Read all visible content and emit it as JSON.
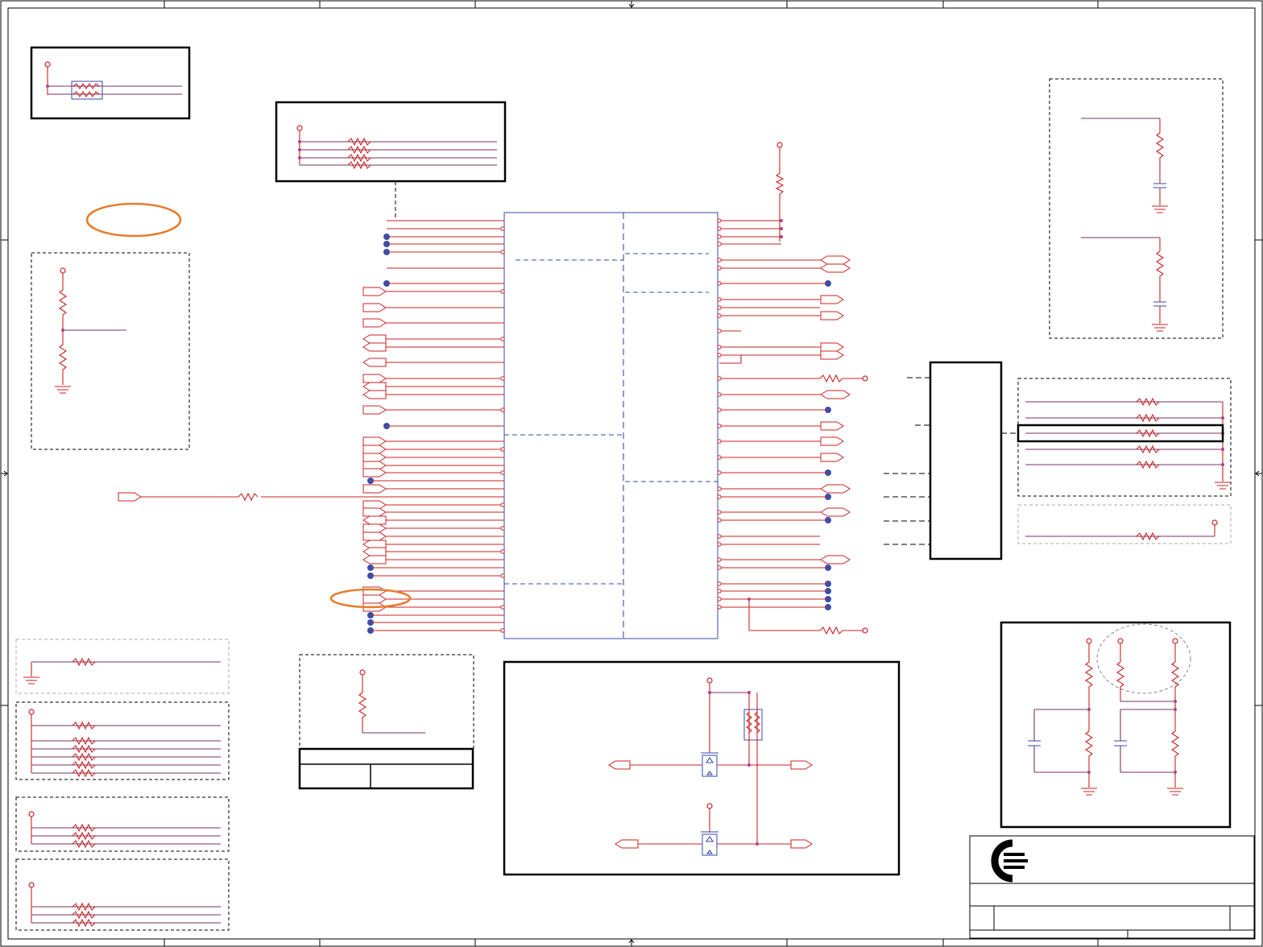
{
  "schematic": {
    "background": "#ffffff",
    "wire_color": "#cc2222",
    "net_color": "#3a4aa8",
    "highlight_color": "#e87b2a",
    "junction_color": "#3550b0",
    "sections": [
      "top-left-resistor-network",
      "pullup-resistor-network",
      "voltage-divider",
      "main-ic",
      "right-rc-filters",
      "right-resistor-bank",
      "interface-connector",
      "level-shifter",
      "divider-bank",
      "bottom-left-resistor-groups",
      "title-block"
    ],
    "title_block": {
      "logo_icon": "company-logo-icon"
    }
  }
}
